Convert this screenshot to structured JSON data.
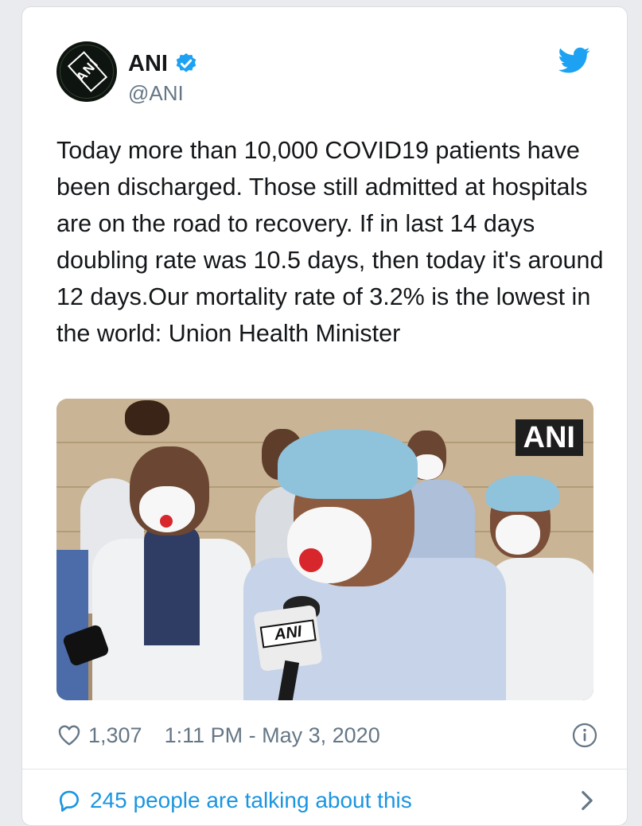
{
  "colors": {
    "brand": "#1da1f2",
    "link": "#1b95e0",
    "text": "#14171a",
    "secondary": "#657786"
  },
  "author": {
    "avatar_text": "ANI",
    "display_name": "ANI",
    "verified_icon": "verified-badge-icon",
    "handle": "@ANI"
  },
  "platform_icon": "twitter-bird-icon",
  "tweet": {
    "text": "Today more than 10,000 COVID19 patients have been discharged. Those still admitted at hospitals are on the road to recovery. If in last 14 days doubling rate was 10.5 days, then today it's around 12 days.Our mortality rate of 3.2% is the lowest in the world: Union Health Minister"
  },
  "media": {
    "watermark": "ANI",
    "mic_label": "ANI"
  },
  "meta": {
    "like_icon": "heart-icon",
    "likes": "1,307",
    "timestamp": "1:11 PM - May 3, 2020",
    "info_icon": "info-icon"
  },
  "conversation": {
    "icon": "speech-bubble-icon",
    "label": "245 people are talking about this",
    "chevron_icon": "chevron-right-icon"
  }
}
